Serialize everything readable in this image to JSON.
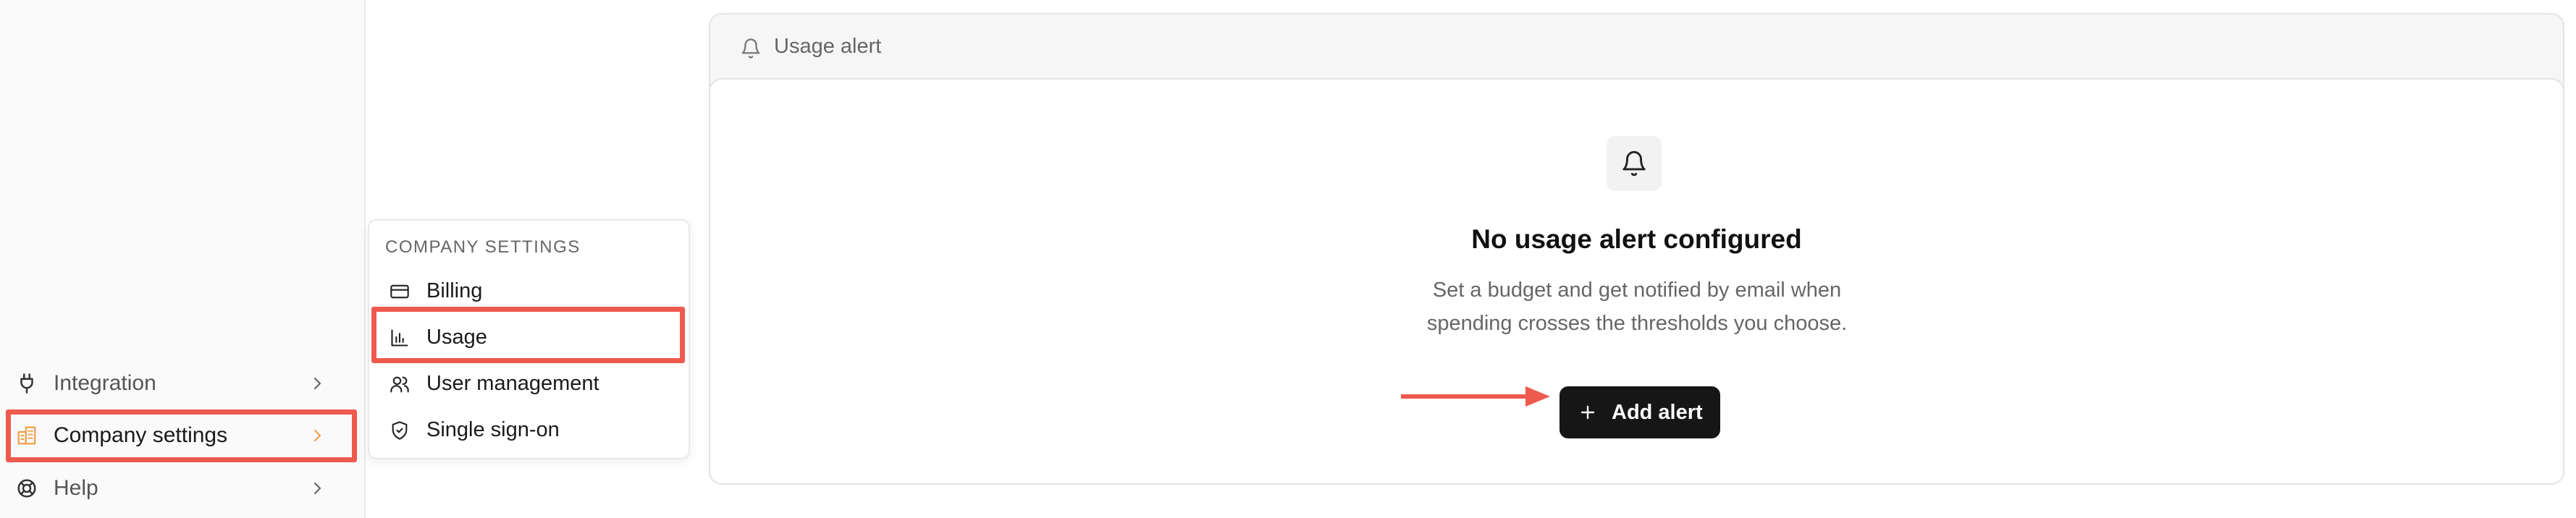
{
  "sidebar": {
    "items": [
      {
        "label": "Integration",
        "icon": "plug-icon"
      },
      {
        "label": "Company settings",
        "icon": "building-icon",
        "active": true
      },
      {
        "label": "Help",
        "icon": "lifebuoy-icon"
      }
    ]
  },
  "flyout": {
    "heading": "COMPANY SETTINGS",
    "items": [
      {
        "label": "Billing",
        "icon": "credit-card-icon"
      },
      {
        "label": "Usage",
        "icon": "bar-chart-icon",
        "selected": true
      },
      {
        "label": "User management",
        "icon": "users-icon"
      },
      {
        "label": "Single sign-on",
        "icon": "shield-check-icon"
      }
    ]
  },
  "card": {
    "title": "Usage alert",
    "empty_state": {
      "title": "No usage alert configured",
      "description_line1": "Set a budget and get notified by email when",
      "description_line2": "spending crosses the thresholds you choose."
    },
    "add_button_label": "Add alert"
  },
  "colors": {
    "highlight": "#ee5a4e",
    "accent_orange": "#f0a050",
    "button_bg": "#161616"
  }
}
